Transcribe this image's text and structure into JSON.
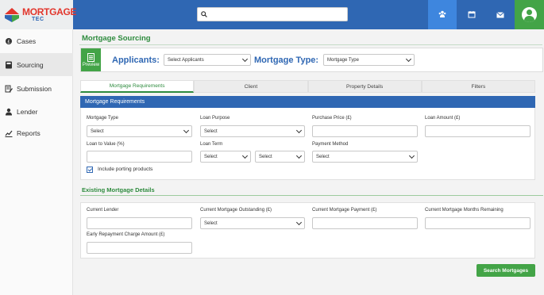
{
  "brand": {
    "name_line1": "MORTGAGE",
    "name_line2": "TEC"
  },
  "topbar": {
    "search_placeholder": ""
  },
  "sidebar": {
    "items": [
      {
        "label": "Cases"
      },
      {
        "label": "Sourcing"
      },
      {
        "label": "Submission"
      },
      {
        "label": "Lender"
      },
      {
        "label": "Reports"
      }
    ]
  },
  "page": {
    "title": "Mortgage Sourcing",
    "preview_label": "Preview",
    "applicants_label": "Applicants:",
    "applicants_select": "Select Applicants",
    "mortgage_type_label": "Mortgage Type:",
    "mortgage_type_select": "Mortgage Type"
  },
  "tabs": [
    {
      "label": "Mortgage Requirements"
    },
    {
      "label": "Client"
    },
    {
      "label": "Property Details"
    },
    {
      "label": "Filters"
    }
  ],
  "requirements": {
    "header": "Mortgage Requirements",
    "mortgage_type": {
      "label": "Mortgage Type",
      "value": "Select"
    },
    "loan_purpose": {
      "label": "Loan Purpose",
      "value": "Select"
    },
    "purchase_price": {
      "label": "Purchase Price (£)"
    },
    "loan_amount": {
      "label": "Loan Amount (£)"
    },
    "ltv": {
      "label": "Loan to Value (%)"
    },
    "loan_term": {
      "label": "Loan Term",
      "years": "Select",
      "months": "Select"
    },
    "payment_method": {
      "label": "Payment Method",
      "value": "Select"
    },
    "porting_label": "Include porting products"
  },
  "existing": {
    "title": "Existing Mortgage Details",
    "current_lender": {
      "label": "Current Lender"
    },
    "outstanding": {
      "label": "Current Mortgage Outstanding (£)",
      "value": "Select"
    },
    "payment": {
      "label": "Current Mortgage Payment (£)"
    },
    "months_remaining": {
      "label": "Current Mortgage Months Remaining"
    },
    "erc": {
      "label": "Early Repayment Charge Amount (£)"
    }
  },
  "actions": {
    "search_label": "Search Mortgages"
  },
  "colors": {
    "primary": "#2f67b3",
    "accent_green": "#43a447",
    "title_green": "#2e8b3e"
  }
}
